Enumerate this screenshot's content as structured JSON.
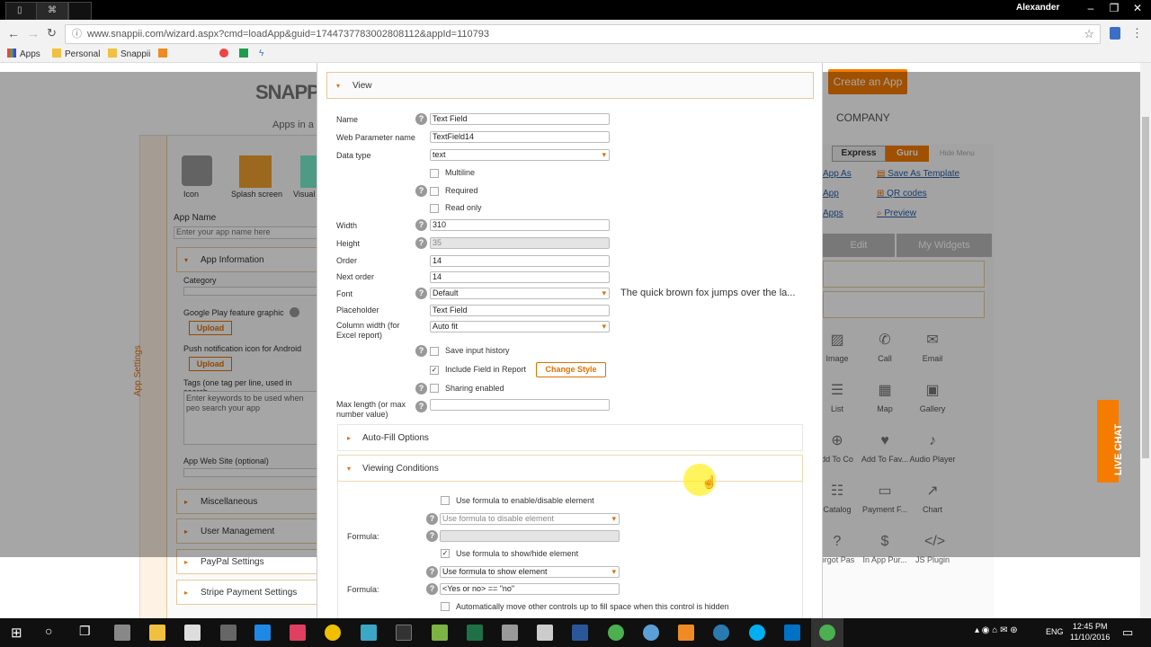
{
  "browser": {
    "user": "Alexander",
    "url": "www.snappii.com/wizard.aspx?cmd=loadApp&guid=1744737783002808112&appId=110793",
    "bookmarks": [
      "Apps",
      "Personal",
      "Snappii"
    ]
  },
  "site": {
    "logo": "SNAPP",
    "tagline": "Apps in a",
    "create_app": "Create an App",
    "company": "COMPANY"
  },
  "left_panel": {
    "tools": [
      "Icon",
      "Splash screen",
      "Visual"
    ],
    "app_name_label": "App Name",
    "app_name_placeholder": "Enter your app name here",
    "app_info": "App Information",
    "category": "Category",
    "google_play": "Google Play feature graphic",
    "upload1": "Upload",
    "push_icon": "Push notification icon for Android",
    "upload2": "Upload",
    "tags": "Tags (one tag per line, used in search",
    "tags_placeholder": "Enter keywords to be used when peo search your app",
    "website": "App Web Site (optional)",
    "side_tab": "App Settings",
    "sections": [
      "Miscellaneous",
      "User Management",
      "PayPal Settings",
      "Stripe Payment Settings"
    ]
  },
  "modal": {
    "view_title": "View",
    "fields": {
      "name_label": "Name",
      "name_value": "Text Field",
      "param_label": "Web Parameter name",
      "param_value": "TextField14",
      "datatype_label": "Data type",
      "datatype_value": "text",
      "multiline": "Multiline",
      "required": "Required",
      "readonly": "Read only",
      "width_label": "Width",
      "width_value": "310",
      "height_label": "Height",
      "height_value": "35",
      "order_label": "Order",
      "order_value": "14",
      "next_order_label": "Next order",
      "next_order_value": "14",
      "font_label": "Font",
      "font_value": "Default",
      "font_preview": "The quick brown fox jumps over the la...",
      "placeholder_label": "Placeholder",
      "placeholder_value": "Text Field",
      "colwidth_label": "Column width (for Excel report)",
      "colwidth_value": "Auto fit",
      "save_history": "Save input history",
      "include_report": "Include Field in Report",
      "change_style": "Change Style",
      "sharing": "Sharing enabled",
      "maxlen_label": "Max length (or max number value)"
    },
    "autofill": "Auto-Fill Options",
    "viewing": "Viewing Conditions",
    "vc": {
      "use_enable": "Use formula to enable/disable element",
      "disable_select": "Use formula to disable element",
      "formula_label1": "Formula:",
      "use_show": "Use formula to show/hide element",
      "show_select": "Use formula to show element",
      "formula_label2": "Formula:",
      "formula2_value": "<Yes or no> == \"no\"",
      "auto_move": "Automatically move other controls up to fill space when this control is hidden"
    }
  },
  "right_panel": {
    "mode_express": "Express",
    "mode_guru": "Guru",
    "hide_menu": "Hide Menu",
    "links": [
      "App As",
      "Save As Template",
      "App",
      "QR codes",
      "Apps",
      "Preview"
    ],
    "tabs": [
      "Edit",
      "My Widgets"
    ],
    "widgets": [
      "Image",
      "Call",
      "Email",
      "List",
      "Map",
      "Gallery",
      "dd To Co",
      "Add To Fav...",
      "Audio Player",
      "Catalog",
      "Payment F...",
      "Chart",
      "orgot Pas",
      "In App Pur...",
      "JS Plugin"
    ],
    "live_chat": "LIVE CHAT"
  },
  "taskbar": {
    "lang": "ENG",
    "time": "12:45 PM",
    "date": "11/10/2016"
  }
}
